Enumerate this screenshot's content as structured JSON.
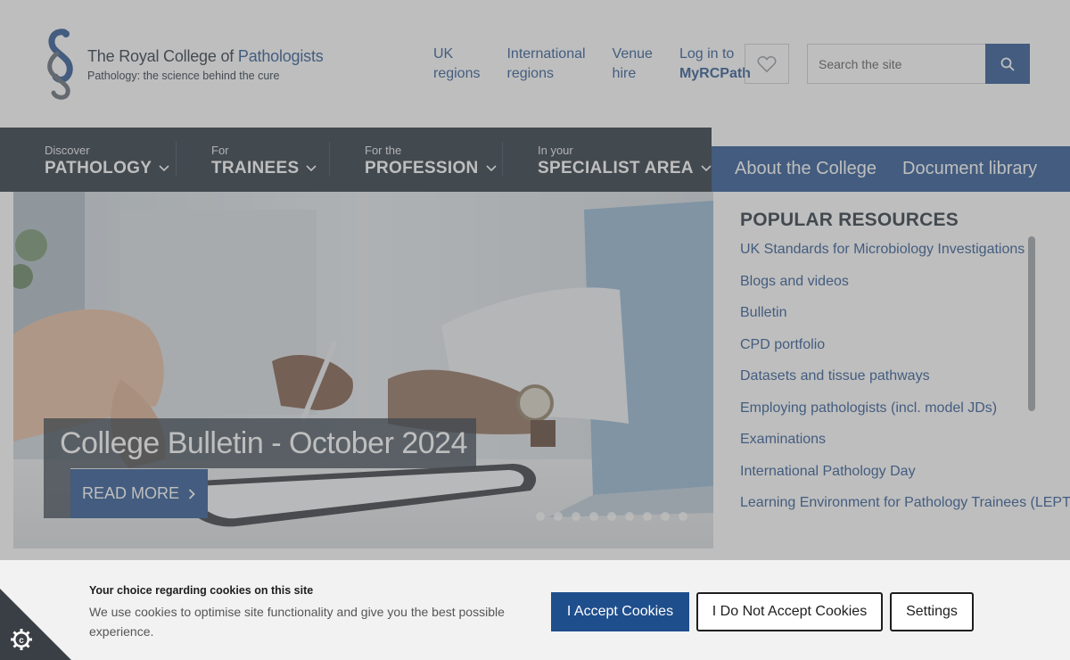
{
  "header": {
    "logo": {
      "title_prefix": "The Royal College of ",
      "title_accent": "Pathologists",
      "subtitle": "Pathology: the science behind the cure"
    },
    "toplinks": [
      {
        "line1": "UK",
        "line2": "regions"
      },
      {
        "line1": "International",
        "line2": "regions"
      },
      {
        "line1": "Venue",
        "line2": "hire"
      },
      {
        "line1": "Log in to",
        "line2": "MyRCPath"
      }
    ],
    "favourites_icon": "heart-icon",
    "search": {
      "placeholder": "Search the site",
      "icon": "search-icon"
    }
  },
  "mainnav": [
    {
      "small": "Discover",
      "big": "PATHOLOGY"
    },
    {
      "small": "For",
      "big": "TRAINEES"
    },
    {
      "small": "For the",
      "big": "PROFESSION"
    },
    {
      "small": "In your",
      "big": "SPECIALIST AREA"
    }
  ],
  "secondary_nav": [
    "About the College",
    "Document library"
  ],
  "hero": {
    "caption": "College Bulletin - October 2024",
    "read_more": "READ MORE",
    "slide_count": 9
  },
  "popular": {
    "title": "POPULAR RESOURCES",
    "items": [
      "UK Standards for Microbiology Investigations",
      "Blogs and videos",
      "Bulletin",
      "CPD portfolio",
      "Datasets and tissue pathways",
      "Employing pathologists (incl. model JDs)",
      "Examinations",
      "International Pathology Day",
      "Learning Environment for Pathology Trainees (LEPT)"
    ]
  },
  "cookies": {
    "title": "Your choice regarding cookies on this site",
    "text": "We use cookies to optimise site functionality and give you the best possible experience.",
    "accept": "I Accept Cookies",
    "decline": "I Do Not Accept Cookies",
    "settings": "Settings",
    "corner_icon": "cookie-settings-icon"
  },
  "colors": {
    "brand_blue": "#1f4e8c",
    "nav_dark": "#1e2a36",
    "cookie_bg": "#f2f2f2"
  }
}
